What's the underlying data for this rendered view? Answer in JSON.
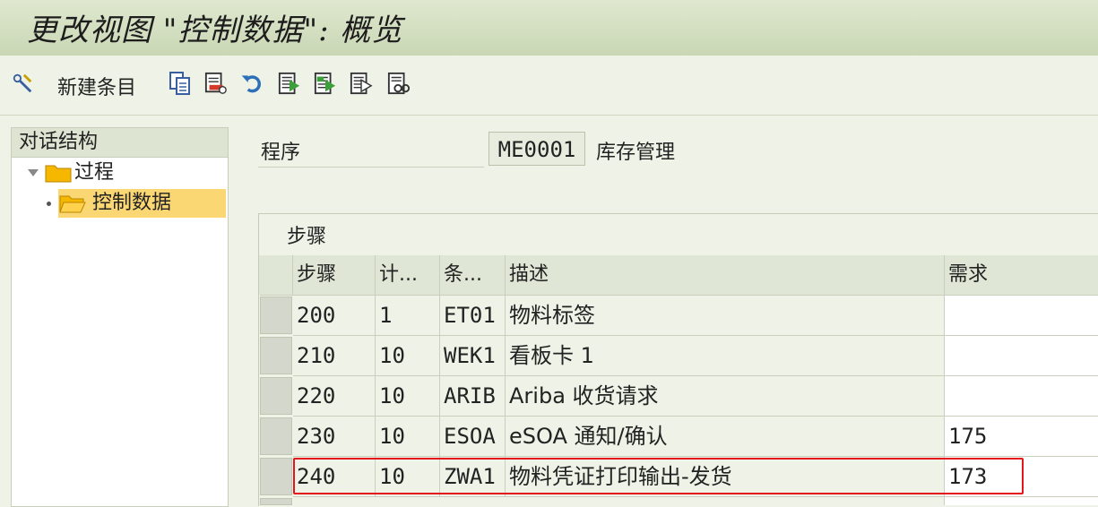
{
  "window": {
    "title": "更改视图 \"控制数据\": 概览"
  },
  "toolbar": {
    "new_entries_label": "新建条目",
    "icons": [
      "display-change-icon",
      "copy-icon",
      "delete-icon",
      "undo-icon",
      "select-all-icon",
      "select-block-icon",
      "deselect-all-icon",
      "choose-icon"
    ]
  },
  "dialog_structure": {
    "header": "对话结构",
    "items": [
      {
        "label": "过程",
        "level": 0,
        "expanded": true
      },
      {
        "label": "控制数据",
        "level": 1,
        "selected": true
      }
    ]
  },
  "program": {
    "label": "程序",
    "value": "ME0001",
    "description": "库存管理"
  },
  "steps": {
    "title": "步骤",
    "columns": [
      "步骤",
      "计...",
      "条...",
      "描述",
      "需求"
    ],
    "rows": [
      {
        "step": "200",
        "counter": "1",
        "condition": "ET01",
        "description": "物料标签",
        "requirement": ""
      },
      {
        "step": "210",
        "counter": "10",
        "condition": "WEK1",
        "description": "看板卡 1",
        "requirement": ""
      },
      {
        "step": "220",
        "counter": "10",
        "condition": "ARIB",
        "description": "Ariba 收货请求",
        "requirement": ""
      },
      {
        "step": "230",
        "counter": "10",
        "condition": "ESOA",
        "description": "eSOA 通知/确认",
        "requirement": "175"
      },
      {
        "step": "240",
        "counter": "10",
        "condition": "ZWA1",
        "description": "物料凭证打印输出-发货",
        "requirement": "173"
      }
    ]
  },
  "colors": {
    "title_bg": "#c9d7b4",
    "selected_tree": "#fbd774",
    "highlight_border": "#e3171b",
    "folder": "#f5b700"
  }
}
